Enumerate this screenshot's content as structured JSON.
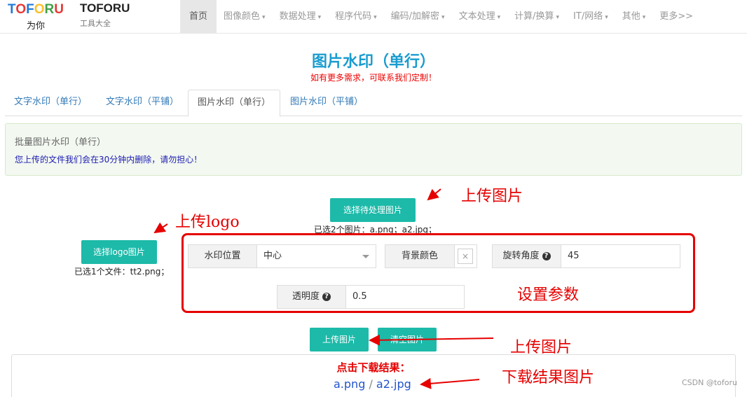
{
  "header": {
    "logo_letters": [
      "T",
      "O",
      "F",
      "O",
      "R",
      "U"
    ],
    "logo_colors": [
      "#1f7ad9",
      "#e53935",
      "#1f7ad9",
      "#fbc02d",
      "#43a047",
      "#e53935"
    ],
    "logo_sub": "为你",
    "brand_name": "TOFORU",
    "brand_tag": "工具大全",
    "menu": [
      "首页",
      "图像颜色",
      "数据处理",
      "程序代码",
      "编码/加解密",
      "文本处理",
      "计算/换算",
      "IT/网络",
      "其他",
      "更多>>"
    ]
  },
  "page": {
    "title": "图片水印（单行）",
    "subtitle": "如有更多需求，可联系我们定制！"
  },
  "tabs": [
    "文字水印（单行）",
    "文字水印（平铺）",
    "图片水印（单行）",
    "图片水印（平铺）"
  ],
  "info": {
    "heading": "批量图片水印（单行）",
    "text": "您上传的文件我们会在30分钟内删除，请勿担心！"
  },
  "upload": {
    "image_button": "选择待处理图片",
    "image_caption": "已选2个图片：a.png；a2.jpg；",
    "logo_button": "选择logo图片",
    "logo_caption": "已选1个文件：tt2.png；"
  },
  "params": {
    "position_label": "水印位置",
    "position_value": "中心",
    "bg_label": "背景颜色",
    "bg_value": "×",
    "rotate_label": "旋转角度",
    "rotate_value": "45",
    "opacity_label": "透明度",
    "opacity_value": "0.5",
    "help_icon": "?"
  },
  "actions": {
    "upload_button": "上传图片",
    "clear_button": "清空图片"
  },
  "result": {
    "label": "点击下载结果：",
    "files": [
      "a.png",
      "a2.jpg"
    ],
    "separator": "/"
  },
  "annotations": {
    "upload_image": "上传图片",
    "upload_logo": "上传logo",
    "set_params": "设置参数",
    "upload_image2": "上传图片",
    "download_result": "下载结果图片"
  },
  "watermark": "CSDN @toforu",
  "colors": {
    "accent": "#1dbaa9",
    "title": "#1a9ccf",
    "annotation": "#e60000"
  }
}
